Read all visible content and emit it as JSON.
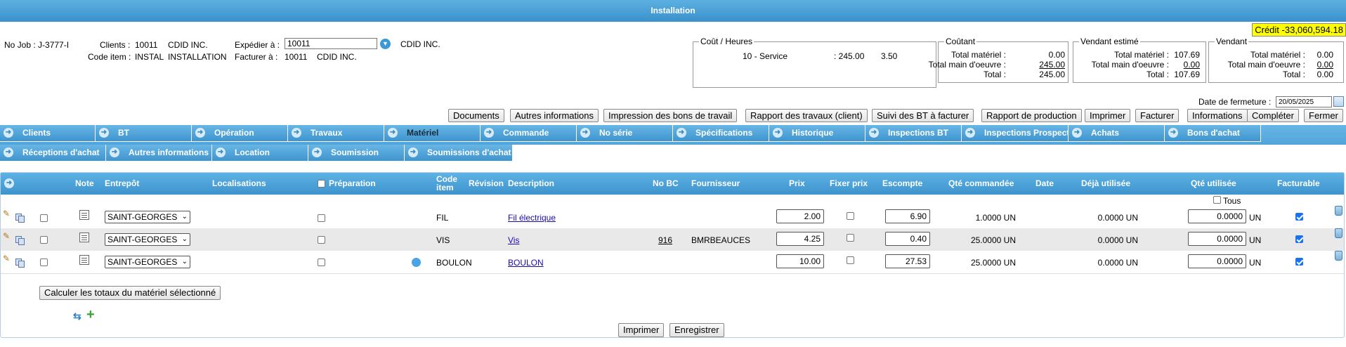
{
  "window": {
    "title": "Installation"
  },
  "credit": "Crédit -33,060,594.18",
  "job": {
    "no_job": "No Job : J-3777-I",
    "clients_label": "Clients :",
    "clients_value": "10011",
    "clients_name": "CDID INC.",
    "code_item_label": "Code item :",
    "code_item_value": "INSTAL",
    "code_item_name": "INSTALLATION",
    "expedier_label": "Expédier à :",
    "expedier_value": "10011",
    "expedier_name": "CDID INC.",
    "facturer_label": "Facturer à :",
    "facturer_value": "10011",
    "facturer_name": "CDID INC."
  },
  "cout_heures": {
    "legend": "Coût / Heures",
    "line_label": "10 - Service",
    "line_value": ": 245.00",
    "line_hours": "3.50"
  },
  "coutant": {
    "legend": "Coûtant",
    "materiel_label": "Total matériel :",
    "materiel_value": "0.00",
    "mo_label": "Total main d'oeuvre :",
    "mo_value": "245.00",
    "total_label": "Total :",
    "total_value": "245.00"
  },
  "vendant_estime": {
    "legend": "Vendant estimé",
    "materiel_label": "Total matériel :",
    "materiel_value": "107.69",
    "mo_label": "Total main d'oeuvre :",
    "mo_value": "0.00",
    "total_label": "Total :",
    "total_value": "107.69"
  },
  "vendant": {
    "legend": "Vendant",
    "materiel_label": "Total matériel :",
    "materiel_value": "0.00",
    "mo_label": "Total main d'oeuvre :",
    "mo_value": "0.00",
    "total_label": "Total :",
    "total_value": "0.00"
  },
  "date_fermeture": {
    "label": "Date de fermeture :",
    "value": "20/05/2025"
  },
  "toolbar": [
    "Documents",
    "Autres informations",
    "Impression des bons de travail",
    "Rapport des travaux (client)",
    "Suivi des BT à facturer",
    "Rapport de production",
    "Imprimer",
    "Facturer",
    "Informations",
    "Compléter",
    "Fermer"
  ],
  "tabs_row1": [
    "Clients",
    "BT",
    "Opération",
    "Travaux",
    "Matériel",
    "Commande",
    "No série",
    "Spécifications",
    "Historique",
    "Inspections BT",
    "Inspections Prospect",
    "Achats",
    "Bons d'achat"
  ],
  "tabs_row2": [
    "Réceptions d'achat",
    "Autres informations",
    "Location",
    "Soumission",
    "Soumissions d'achat"
  ],
  "active_tab": "Matériel",
  "table": {
    "headers": {
      "note": "Note",
      "entrepot": "Entrepôt",
      "localisations": "Localisations",
      "preparation": "Préparation",
      "code_item_1": "Code",
      "code_item_2": "item",
      "revision": "Révision",
      "description": "Description",
      "no_bc": "No BC",
      "fournisseur": "Fournisseur",
      "prix": "Prix",
      "fixer_prix": "Fixer prix",
      "escompte": "Escompte",
      "qte_commandee": "Qté commandée",
      "date": "Date",
      "deja_utilisee": "Déjà utilisée",
      "qte_utilisee": "Qté utilisée",
      "facturable": "Facturable"
    },
    "tous_label": "Tous",
    "rows": [
      {
        "entrepot": "SAINT-GEORGES",
        "code": "FIL",
        "description": "Fil électrique",
        "no_bc": "",
        "fournisseur": "",
        "prix": "2.00",
        "escompte": "6.90",
        "qte_commandee": "1.0000 UN",
        "deja_utilisee": "0.0000 UN",
        "qte_utilisee": "0.0000",
        "unit": "UN",
        "facturable": true,
        "revision_dot": false
      },
      {
        "entrepot": "SAINT-GEORGES",
        "code": "VIS",
        "description": "Vis",
        "no_bc": "916",
        "fournisseur": "BMRBEAUCES",
        "prix": "4.25",
        "escompte": "0.40",
        "qte_commandee": "25.0000 UN",
        "deja_utilisee": "0.0000 UN",
        "qte_utilisee": "0.0000",
        "unit": "UN",
        "facturable": true,
        "revision_dot": false
      },
      {
        "entrepot": "SAINT-GEORGES",
        "code": "BOULON",
        "description": "BOULON",
        "no_bc": "",
        "fournisseur": "",
        "prix": "10.00",
        "escompte": "27.53",
        "qte_commandee": "25.0000 UN",
        "deja_utilisee": "0.0000 UN",
        "qte_utilisee": "0.0000",
        "unit": "UN",
        "facturable": true,
        "revision_dot": true
      }
    ]
  },
  "calc_button": "Calculer les totaux du matériel sélectionné",
  "footer": {
    "print": "Imprimer",
    "save": "Enregistrer"
  }
}
